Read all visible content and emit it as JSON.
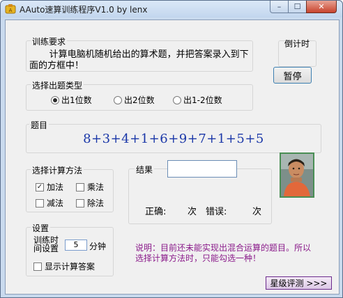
{
  "window": {
    "title": "AAuto速算训练程序V1.0 by lenx",
    "close_glyph": "✕",
    "max_glyph": "☐",
    "min_glyph": "–"
  },
  "requirements": {
    "label": "训练要求",
    "text": "计算电脑机随机给出的算术题，并把答案录入到下面的方框中！"
  },
  "countdown": {
    "label": "倒计时"
  },
  "digit_type": {
    "label": "选择出题类型",
    "options": [
      {
        "label": "出1位数",
        "selected": true
      },
      {
        "label": "出2位数",
        "selected": false
      },
      {
        "label": "出1-2位数",
        "selected": false
      }
    ]
  },
  "pause_button": "暂停",
  "problem": {
    "label": "题目",
    "expression": "8+3+4+1+6+9+7+1+5+5"
  },
  "methods": {
    "label": "选择计算方法",
    "options": [
      {
        "label": "加法",
        "checked": true
      },
      {
        "label": "乘法",
        "checked": false
      },
      {
        "label": "减法",
        "checked": false
      },
      {
        "label": "除法",
        "checked": false
      }
    ]
  },
  "result": {
    "label": "结果",
    "answer_value": "",
    "correct_label": "正确:",
    "correct_unit": "次",
    "wrong_label": "错误:",
    "wrong_unit": "次"
  },
  "settings": {
    "label": "设置",
    "time_label": "训练时间设置",
    "time_value": "5",
    "time_unit": "分钟",
    "show_answer_label": "显示计算答案",
    "show_answer_checked": false
  },
  "note": "说明：目前还未能实现出混合运算的题目。所以选择计算方法时，只能勾选一种！",
  "star_button": "星级评测 >>>",
  "colors": {
    "problem_text": "#1a37a8",
    "note_text": "#8a1a8a"
  }
}
